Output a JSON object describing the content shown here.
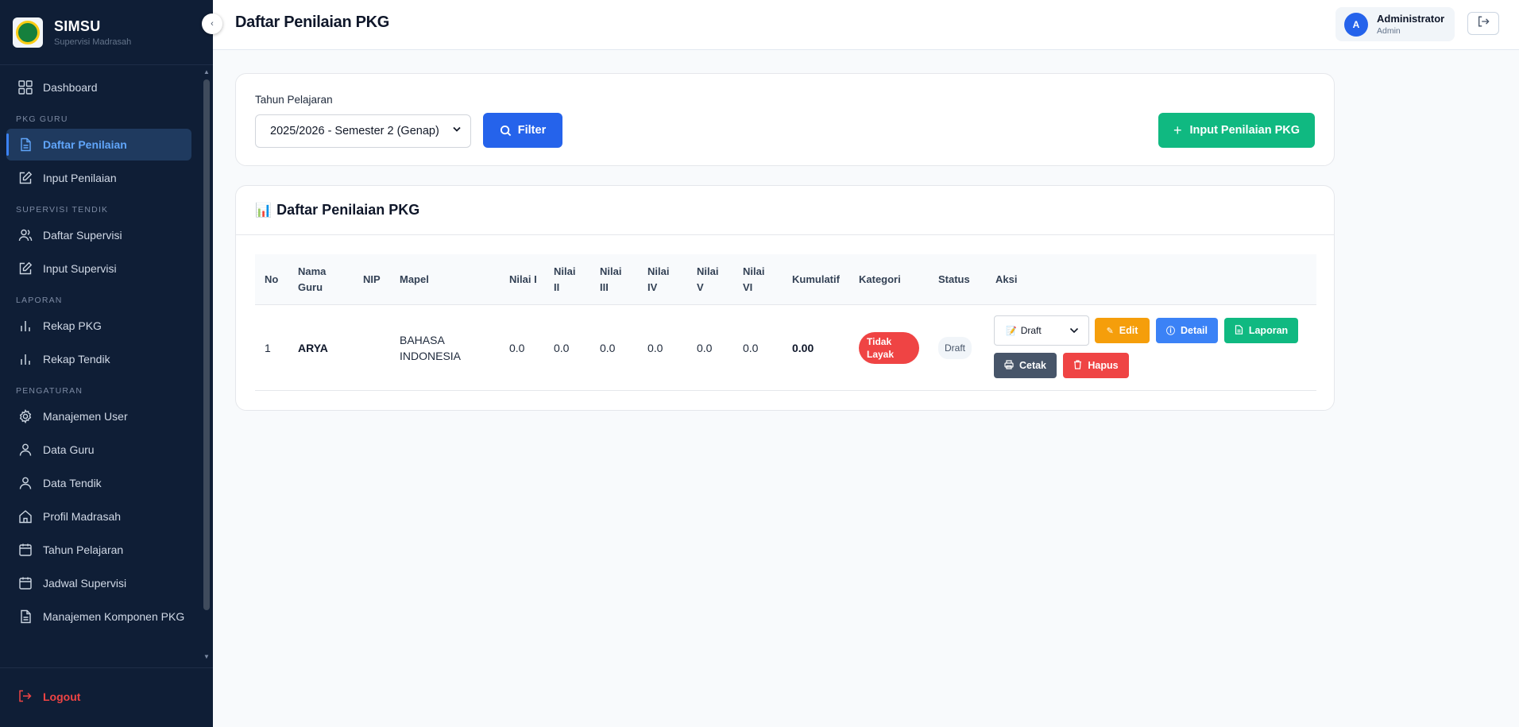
{
  "sidebar": {
    "brand_title": "SIMSU",
    "brand_subtitle": "Supervisi Madrasah",
    "collapse_icon": "chevron-left-icon",
    "items": [
      {
        "label": "Dashboard",
        "icon": "grid-icon"
      },
      {
        "section": "PKG GURU"
      },
      {
        "label": "Daftar Penilaian",
        "icon": "document-icon",
        "active": true
      },
      {
        "label": "Input Penilaian",
        "icon": "edit-icon"
      },
      {
        "section": "SUPERVISI TENDIK"
      },
      {
        "label": "Daftar Supervisi",
        "icon": "users-icon"
      },
      {
        "label": "Input Supervisi",
        "icon": "edit-icon"
      },
      {
        "section": "LAPORAN"
      },
      {
        "label": "Rekap PKG",
        "icon": "bar-chart-icon"
      },
      {
        "label": "Rekap Tendik",
        "icon": "bar-chart-icon"
      },
      {
        "section": "PENGATURAN"
      },
      {
        "label": "Manajemen User",
        "icon": "gear-icon"
      },
      {
        "label": "Data Guru",
        "icon": "user-icon"
      },
      {
        "label": "Data Tendik",
        "icon": "user-icon"
      },
      {
        "label": "Profil Madrasah",
        "icon": "home-icon"
      },
      {
        "label": "Tahun Pelajaran",
        "icon": "calendar-icon"
      },
      {
        "label": "Jadwal Supervisi",
        "icon": "calendar-icon"
      },
      {
        "label": "Manajemen Komponen PKG",
        "icon": "document-icon"
      }
    ],
    "logout_label": "Logout"
  },
  "header": {
    "title": "Daftar Penilaian PKG",
    "user_initial": "A",
    "user_name": "Administrator",
    "user_role": "Admin"
  },
  "filter": {
    "label": "Tahun Pelajaran",
    "selected": "2025/2026 - Semester 2 (Genap)",
    "filter_button": "Filter",
    "input_button": "Input Penilaian PKG"
  },
  "list": {
    "title": "Daftar Penilaian PKG",
    "title_emoji": "📊",
    "columns": [
      "No",
      "Nama Guru",
      "NIP",
      "Mapel",
      "Nilai I",
      "Nilai II",
      "Nilai III",
      "Nilai IV",
      "Nilai V",
      "Nilai VI",
      "Kumulatif",
      "Kategori",
      "Status",
      "Aksi"
    ],
    "rows": [
      {
        "no": "1",
        "nama": "ARYA",
        "nip": "",
        "mapel": "BAHASA INDONESIA",
        "n1": "0.0",
        "n2": "0.0",
        "n3": "0.0",
        "n4": "0.0",
        "n5": "0.0",
        "n6": "0.0",
        "kumulatif": "0.00",
        "kategori": "Tidak Layak",
        "status": "Draft",
        "status_select": "Draft",
        "actions": {
          "edit": "Edit",
          "detail": "Detail",
          "laporan": "Laporan",
          "cetak": "Cetak",
          "hapus": "Hapus"
        }
      }
    ]
  },
  "colors": {
    "sidebar_bg": "#0f1e36",
    "primary": "#2563eb",
    "success": "#10b981",
    "warning": "#f59e0b",
    "danger": "#ef4444",
    "dark": "#475569"
  }
}
